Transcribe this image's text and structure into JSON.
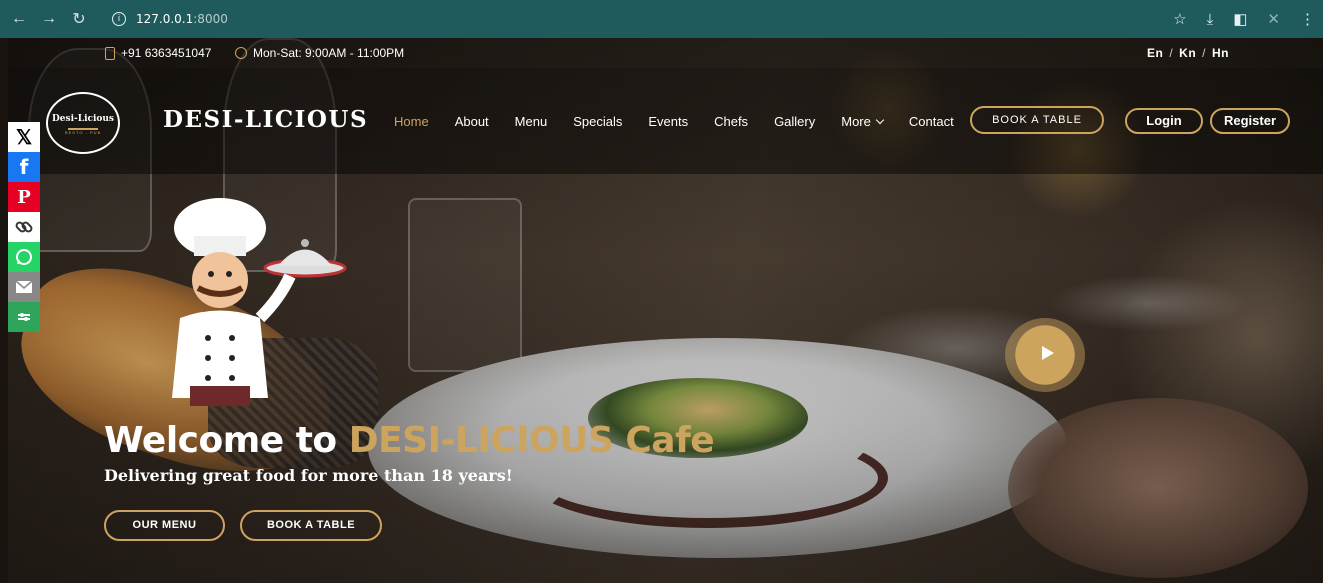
{
  "browser": {
    "url_host": "127.0.0.1",
    "url_port": ":8000",
    "back_icon": "arrow-left-icon",
    "forward_icon": "arrow-right-icon",
    "reload_icon": "reload-icon",
    "info_icon": "info-icon",
    "star_icon": "star-icon",
    "download_icon": "download-icon",
    "sidepanel_icon": "sidepanel-icon",
    "extension_icon": "extension-icon",
    "menu_icon": "kebab-menu-icon"
  },
  "topbar": {
    "phone": "+91 6363451047",
    "hours": "Mon-Sat: 9:00AM - 11:00PM",
    "languages": [
      "En",
      "Kn",
      "Hn"
    ]
  },
  "logo": {
    "name": "Desi-Licious",
    "tagline": "RESTO - PUB"
  },
  "brand": "DESI-LICIOUS",
  "nav": {
    "items": [
      "Home",
      "About",
      "Menu",
      "Specials",
      "Events",
      "Chefs",
      "Gallery",
      "More",
      "Contact"
    ],
    "active": "Home"
  },
  "header_buttons": {
    "book_table": "BOOK A TABLE",
    "login": "Login",
    "register": "Register"
  },
  "social": [
    "x-icon",
    "facebook-icon",
    "pinterest-icon",
    "copy-link-icon",
    "whatsapp-icon",
    "email-icon",
    "more-share-icon"
  ],
  "hero": {
    "title_prefix": "Welcome to ",
    "title_highlight": "DESI-LICIOUS Cafe",
    "subtitle": "Delivering great food for more than 18 years!",
    "button_menu": "OUR MENU",
    "button_book": "BOOK A TABLE"
  },
  "colors": {
    "accent": "#cda45e",
    "browser_bar": "#1f5a5c"
  }
}
